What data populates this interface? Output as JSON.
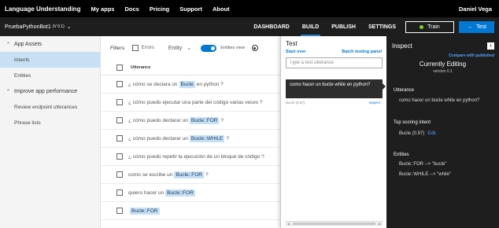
{
  "topnav": {
    "brand": "Language Understanding",
    "items": [
      "My apps",
      "Docs",
      "Pricing",
      "Support",
      "About"
    ],
    "user": "Daniel Vega"
  },
  "appbar": {
    "app_name": "PruebaPythonBot1",
    "version": "(V 0.1)",
    "tabs": [
      "DASHBOARD",
      "BUILD",
      "PUBLISH",
      "SETTINGS"
    ],
    "active_tab": "BUILD",
    "train_label": "Train",
    "test_label": "Test",
    "train_status_color": "#7ed321",
    "accent_color": "#0078d4"
  },
  "sidebar": {
    "section_assets": "App Assets",
    "items_assets": [
      "Intents",
      "Entities"
    ],
    "section_improve": "Improve app performance",
    "items_improve": [
      "Review endpoint utterances",
      "Phrase lists"
    ]
  },
  "main": {
    "filters_label": "Filters:",
    "errors_label": "Errors",
    "entity_dropdown": "Entity",
    "entities_view_label": "Entities view",
    "utterance_header": "Utterance",
    "utterances": [
      {
        "pre": "¿ cómo se declara un ",
        "entity": "Bucle",
        "post": " en python ?"
      },
      {
        "pre": "¿ cómo puedo ejecutar una parte del código varias veces ?",
        "entity": "",
        "post": ""
      },
      {
        "pre": "¿ cómo puedo declarar un ",
        "entity": "Bucle::FOR",
        "post": " ?"
      },
      {
        "pre": "¿ cómo puedo declarar un ",
        "entity": "Bucle::WHILE",
        "post": " ?"
      },
      {
        "pre": "¿ cómo puedo repetir la ejecución de un bloque de código ?",
        "entity": "",
        "post": ""
      },
      {
        "pre": "como se escribe un ",
        "entity": "Bucle::FOR",
        "post": " ?"
      },
      {
        "pre": "quiero hacer un ",
        "entity": "Bucle::FOR",
        "post": ""
      },
      {
        "pre": "",
        "entity": "Bucle::FOR",
        "post": ""
      }
    ]
  },
  "test": {
    "title": "Test",
    "start_over": "Start over",
    "batch": "Batch testing panel",
    "placeholder": "Type a test utterance",
    "bubble": "como hacer un bucle while en python?",
    "intent_score": "Bucle (0.97)",
    "inspect_link": "Inspect"
  },
  "inspect": {
    "title": "Inspect",
    "compare": "Compare with published",
    "editing": "Currently Editing",
    "version": "version 0.1",
    "utterance_label": "Utterance",
    "utterance": "como hacer un bucle while en python?",
    "top_intent_label": "Top scoring intent",
    "top_intent": "Bucle (0.97)",
    "edit_label": "Edit",
    "entities_label": "Entities",
    "entities": [
      "Bucle::FOR --> \"bucle\"",
      "Bucle::WHILE --> \"while\""
    ]
  }
}
